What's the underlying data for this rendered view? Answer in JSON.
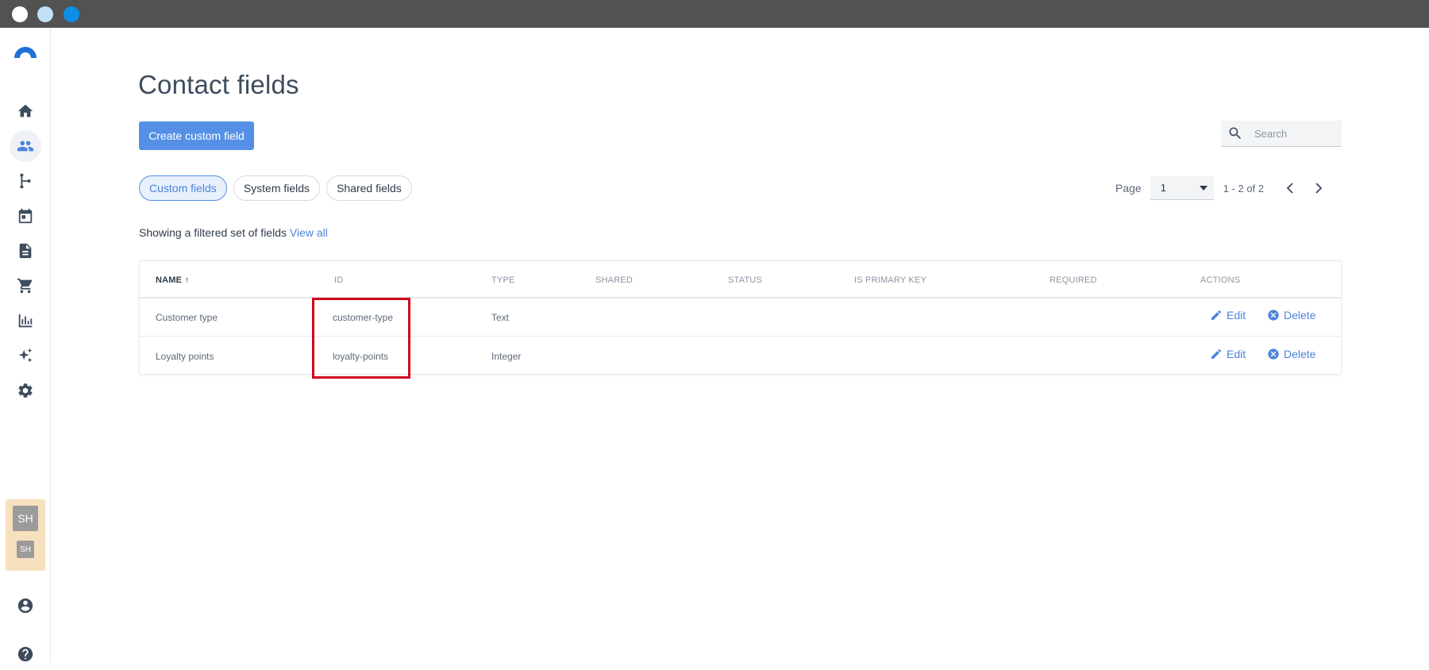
{
  "sidebar": {
    "items": [
      {
        "name": "home",
        "icon": "home-icon"
      },
      {
        "name": "contacts",
        "icon": "people-icon",
        "active": true
      },
      {
        "name": "journeys",
        "icon": "branch-icon"
      },
      {
        "name": "calendar",
        "icon": "calendar-icon"
      },
      {
        "name": "content",
        "icon": "document-icon"
      },
      {
        "name": "commerce",
        "icon": "cart-icon"
      },
      {
        "name": "analytics",
        "icon": "bar-chart-icon"
      },
      {
        "name": "ai",
        "icon": "sparkle-icon"
      },
      {
        "name": "settings",
        "icon": "gear-icon"
      }
    ],
    "avatar_big": "SH",
    "avatar_small": "SH"
  },
  "header": {
    "title": "Contact fields",
    "create_button": "Create custom field",
    "search_placeholder": "Search"
  },
  "tabs": [
    {
      "label": "Custom fields",
      "active": true
    },
    {
      "label": "System fields",
      "active": false
    },
    {
      "label": "Shared fields",
      "active": false
    }
  ],
  "pagination": {
    "label": "Page",
    "current": "1",
    "range": "1 - 2 of 2"
  },
  "filter": {
    "text": "Showing a filtered set of fields",
    "link": "View all"
  },
  "table": {
    "columns": [
      "NAME",
      "ID",
      "TYPE",
      "SHARED",
      "STATUS",
      "IS PRIMARY KEY",
      "REQUIRED",
      "ACTIONS"
    ],
    "sort_arrow": "↑",
    "rows": [
      {
        "name": "Customer type",
        "id": "customer-type",
        "type": "Text",
        "edit": "Edit",
        "delete": "Delete"
      },
      {
        "name": "Loyalty points",
        "id": "loyalty-points",
        "type": "Integer",
        "edit": "Edit",
        "delete": "Delete"
      }
    ]
  },
  "colors": {
    "accent": "#5690e6",
    "link": "#4b84db",
    "highlight": "#d0021b"
  }
}
